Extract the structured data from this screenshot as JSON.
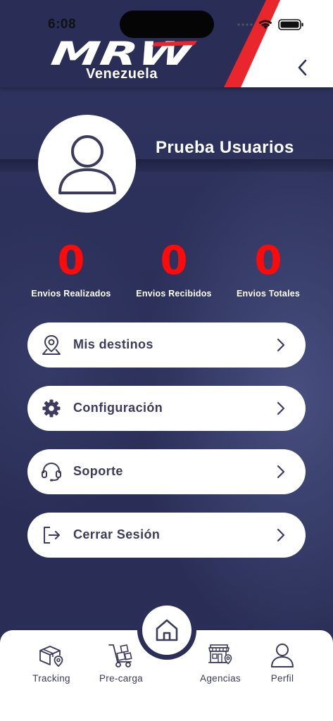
{
  "status_bar": {
    "time": "6:08"
  },
  "header": {
    "logo_text": "MRW",
    "logo_subtitle": "Venezuela",
    "back_icon": "chevron-left-icon"
  },
  "profile": {
    "avatar_icon": "user-icon",
    "name": "Prueba Usuarios"
  },
  "stats": [
    {
      "value": "0",
      "label": "Envios Realizados"
    },
    {
      "value": "0",
      "label": "Envios Recibidos"
    },
    {
      "value": "0",
      "label": "Envios Totales"
    }
  ],
  "menu": [
    {
      "label": "Mis destinos",
      "icon": "location-pin-icon"
    },
    {
      "label": "Configuración",
      "icon": "gear-icon"
    },
    {
      "label": "Soporte",
      "icon": "headset-icon"
    },
    {
      "label": "Cerrar Sesión",
      "icon": "logout-icon"
    }
  ],
  "bottom_nav": {
    "home_icon": "home-icon",
    "items": [
      {
        "label": "Tracking",
        "icon": "package-location-icon"
      },
      {
        "label": "Pre-carga",
        "icon": "hand-truck-icon"
      },
      {
        "label": "Agencias",
        "icon": "store-location-icon"
      },
      {
        "label": "Perfil",
        "icon": "user-icon"
      }
    ]
  },
  "colors": {
    "background": "#2c3058",
    "accent_red": "#e8262b",
    "stat_number": "#ff0a0a",
    "menu_text": "#3c3a5e",
    "white": "#ffffff"
  }
}
